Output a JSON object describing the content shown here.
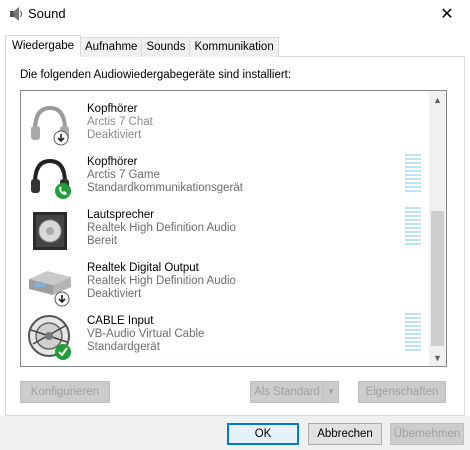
{
  "window": {
    "title": "Sound",
    "close_glyph": "✕"
  },
  "tabs": [
    {
      "label": "Wiedergabe",
      "active": true
    },
    {
      "label": "Aufnahme",
      "active": false
    },
    {
      "label": "Sounds",
      "active": false
    },
    {
      "label": "Kommunikation",
      "active": false
    }
  ],
  "instruction": "Die folgenden Audiowiedergabegeräte sind installiert:",
  "devices": [
    {
      "name": "Kopfhörer",
      "model": "Arctis 7 Chat",
      "status": "Deaktiviert",
      "icon": "headphones-icon",
      "badge": "disabled-down-arrow"
    },
    {
      "name": "Kopfhörer",
      "model": "Arctis 7 Game",
      "status": "Standardkommunikationsgerät",
      "icon": "headphones-icon",
      "badge": "phone-check"
    },
    {
      "name": "Lautsprecher",
      "model": "Realtek High Definition Audio",
      "status": "Bereit",
      "icon": "speaker-icon",
      "badge": "none"
    },
    {
      "name": "Realtek Digital Output",
      "model": "Realtek High Definition Audio",
      "status": "Deaktiviert",
      "icon": "digital-output-icon",
      "badge": "disabled-down-arrow"
    },
    {
      "name": "CABLE Input",
      "model": "VB-Audio Virtual Cable",
      "status": "Standardgerät",
      "icon": "cable-icon",
      "badge": "default-check"
    }
  ],
  "buttons": {
    "configure": "Konfigurieren",
    "set_default": "Als Standard",
    "properties": "Eigenschaften",
    "ok": "OK",
    "cancel": "Abbrechen",
    "apply": "Übernehmen"
  },
  "colors": {
    "accent": "#0078d7",
    "check_green": "#1e9e3a",
    "level_bar": "#bfe3f3"
  }
}
